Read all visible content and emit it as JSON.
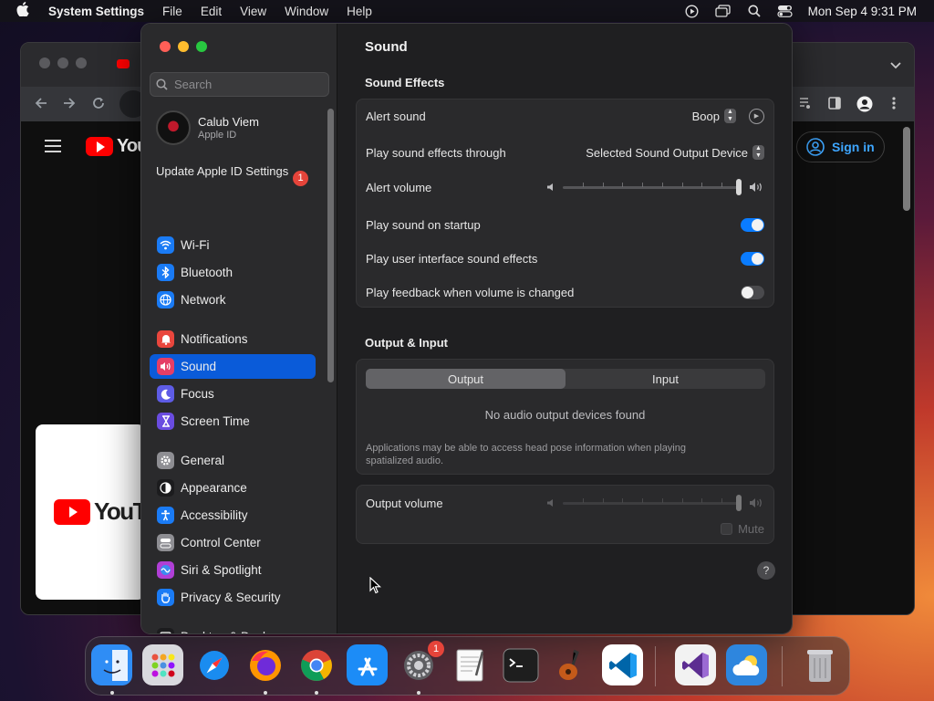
{
  "menubar": {
    "apple_icon": "apple-logo-icon",
    "app_name": "System Settings",
    "menus": [
      "File",
      "Edit",
      "View",
      "Window",
      "Help"
    ],
    "clock": "Mon Sep 4  9:31 PM"
  },
  "browser": {
    "youtube_logo_text": "YouTube",
    "signin_label": "Sign in"
  },
  "settings": {
    "search_placeholder": "Search",
    "profile": {
      "name": "Calub Viem",
      "subtitle": "Apple ID"
    },
    "update": {
      "label": "Update Apple ID Settings",
      "badge": "1"
    },
    "sidebar": [
      {
        "label": "Wi-Fi",
        "icon": "wifi-icon",
        "color": "#1a7bf5"
      },
      {
        "label": "Bluetooth",
        "icon": "bluetooth-icon",
        "color": "#1a7bf5"
      },
      {
        "label": "Network",
        "icon": "globe-icon",
        "color": "#1a7bf5"
      },
      {
        "label": "Notifications",
        "icon": "bell-icon",
        "color": "#e9463d"
      },
      {
        "label": "Sound",
        "icon": "speaker-icon",
        "color": "#e53e66",
        "selected": true
      },
      {
        "label": "Focus",
        "icon": "moon-icon",
        "color": "#5e5ce6"
      },
      {
        "label": "Screen Time",
        "icon": "hourglass-icon",
        "color": "#6a4ce0"
      },
      {
        "label": "General",
        "icon": "gear-icon",
        "color": "#8e8e93"
      },
      {
        "label": "Appearance",
        "icon": "appearance-icon",
        "color": "#1c1c1e"
      },
      {
        "label": "Accessibility",
        "icon": "accessibility-icon",
        "color": "#1a7bf5"
      },
      {
        "label": "Control Center",
        "icon": "control-center-icon",
        "color": "#8e8e93"
      },
      {
        "label": "Siri & Spotlight",
        "icon": "siri-icon",
        "color": "#b03fd6"
      },
      {
        "label": "Privacy & Security",
        "icon": "hand-icon",
        "color": "#1a7bf5"
      },
      {
        "label": "Desktop & Dock",
        "icon": "dock-icon",
        "color": "#1c1c1e"
      }
    ],
    "main": {
      "title": "Sound",
      "sound_effects": {
        "heading": "Sound Effects",
        "alert_sound": {
          "label": "Alert sound",
          "value": "Boop"
        },
        "play_through": {
          "label": "Play sound effects through",
          "value": "Selected Sound Output Device"
        },
        "alert_volume": {
          "label": "Alert volume",
          "level": 1.0
        },
        "startup": {
          "label": "Play sound on startup",
          "on": true
        },
        "ui_effects": {
          "label": "Play user interface sound effects",
          "on": true
        },
        "feedback": {
          "label": "Play feedback when volume is changed",
          "on": false
        }
      },
      "output_input": {
        "heading": "Output & Input",
        "tabs": [
          "Output",
          "Input"
        ],
        "active_tab": "Output",
        "empty_message": "No audio output devices found",
        "note": "Applications may be able to access head pose information when playing spatialized audio."
      },
      "output_volume": {
        "label": "Output volume",
        "level": 1.0,
        "mute_label": "Mute",
        "muted": false
      },
      "help_label": "?"
    }
  },
  "dock": {
    "apps": [
      {
        "name": "Finder",
        "icon": "finder-icon",
        "color": "#2f8df5",
        "running": true
      },
      {
        "name": "Launchpad",
        "icon": "launchpad-icon",
        "color": "#d9d9de",
        "running": false
      },
      {
        "name": "Safari",
        "icon": "safari-icon",
        "color": "#f0f0f5",
        "running": false
      },
      {
        "name": "Firefox",
        "icon": "firefox-icon",
        "color": "#e66a1a",
        "running": true
      },
      {
        "name": "Chrome",
        "icon": "chrome-icon",
        "color": "#f2f2f2",
        "running": true
      },
      {
        "name": "App Store",
        "icon": "app-store-icon",
        "color": "#1c8cf7",
        "running": false
      },
      {
        "name": "System Settings",
        "icon": "system-settings-icon",
        "color": "#8e8e93",
        "running": true,
        "badge": "1"
      },
      {
        "name": "TextEdit",
        "icon": "textedit-icon",
        "color": "#f4f4f4",
        "running": false
      },
      {
        "name": "Terminal",
        "icon": "terminal-icon",
        "color": "#1e1e1e",
        "running": false
      },
      {
        "name": "GarageBand",
        "icon": "garageband-icon",
        "color": "#2a1e14",
        "running": false
      },
      {
        "name": "Visual Studio Code",
        "icon": "vscode-icon",
        "color": "#ffffff",
        "running": false
      },
      {
        "name": "Visual Studio",
        "icon": "visual-studio-icon",
        "color": "#f2f2f2",
        "running": false
      },
      {
        "name": "Weather",
        "icon": "weather-icon",
        "color": "#2e86de",
        "running": false
      },
      {
        "name": "Trash",
        "icon": "trash-icon",
        "color": "#6a6a6e",
        "running": false
      }
    ]
  }
}
